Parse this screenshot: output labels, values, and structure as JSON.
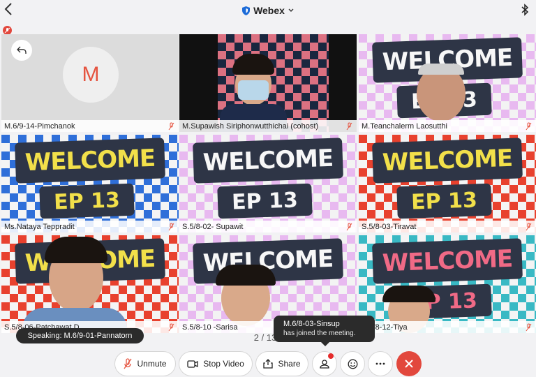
{
  "header": {
    "app_title": "Webex",
    "title_icon": "shield-icon",
    "back_icon": "chevron-left-icon",
    "bluetooth_icon": "bluetooth-icon"
  },
  "participants": [
    {
      "name": "M.6/9-14-Pimchanok",
      "avatar_letter": "M"
    },
    {
      "name": "M.Supawish Siriphonwutthichai (cohost)"
    },
    {
      "name": "M.Teanchalerm Laosutthi"
    },
    {
      "name": "Ms.Nataya Teppradit"
    },
    {
      "name": "S.5/8-02- Supawit"
    },
    {
      "name": "S.5/8-03-Tiravat"
    },
    {
      "name": "S.5/8-06-Patchawat D"
    },
    {
      "name": "S.5/8-10 -Sarisa"
    },
    {
      "name": "S.5/8-12-Tiya"
    }
  ],
  "artwork": {
    "welcome_text": "WELCOME",
    "ep_text": "EP 13"
  },
  "notifications": {
    "speaking": "Speaking: M.6/9-01-Pannatorn",
    "joined_name": "M.6/8-03-Sinsup",
    "joined_text": "has joined the meeting."
  },
  "pagination": "2 / 13",
  "controls": {
    "unmute_label": "Unmute",
    "stop_video_label": "Stop Video",
    "share_label": "Share"
  },
  "colors": {
    "accent_red": "#e2483d",
    "brand_blue": "#1c6bd8"
  }
}
